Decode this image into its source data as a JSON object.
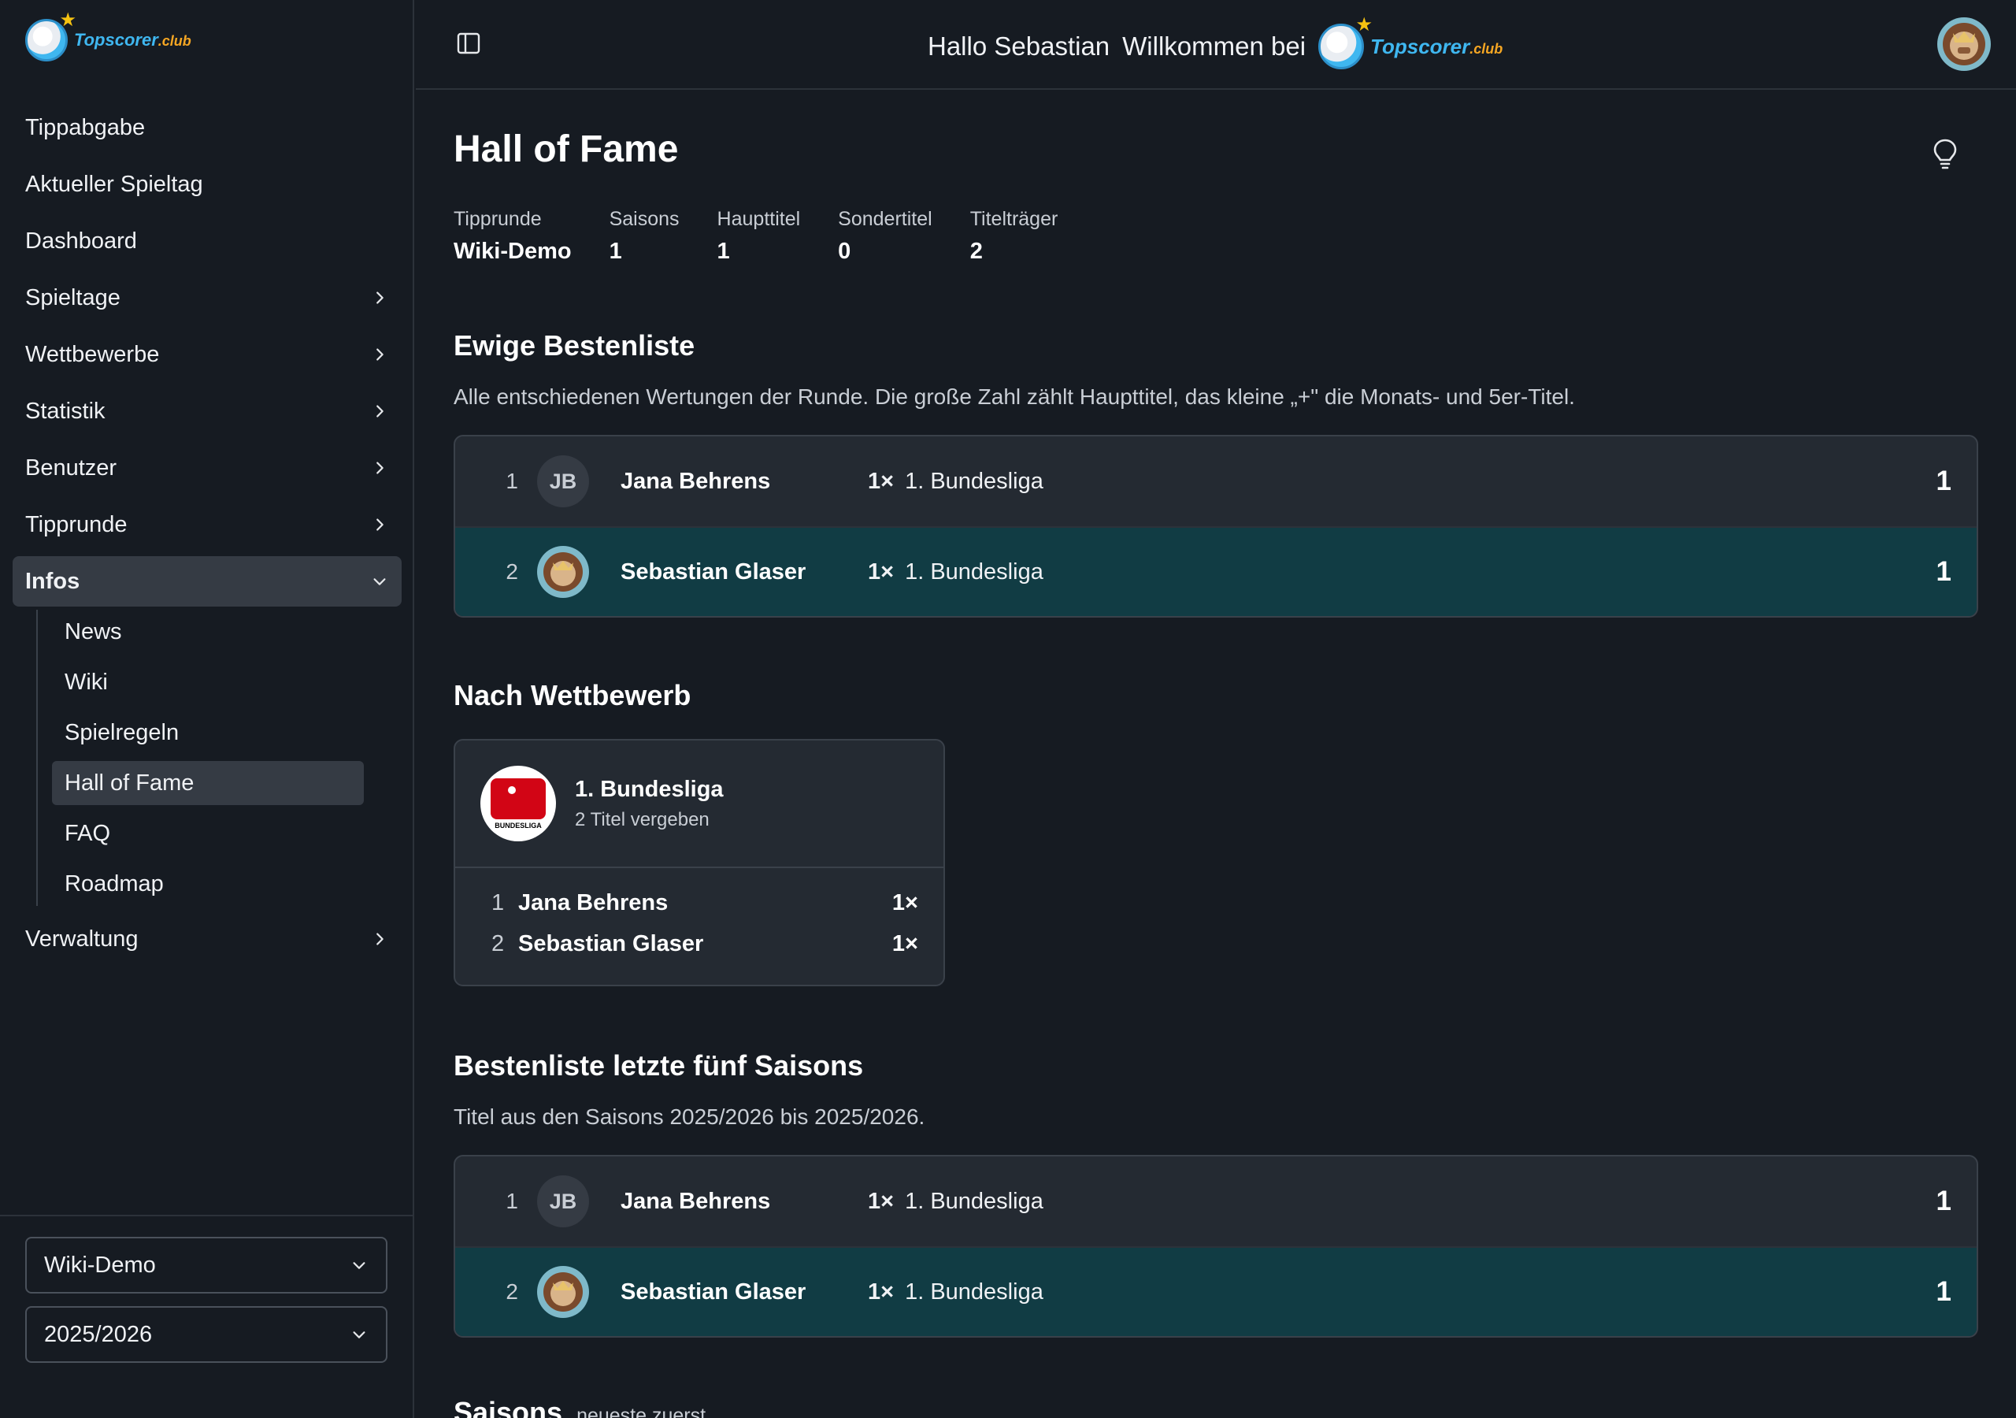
{
  "brand": {
    "name": "Topscorer",
    "suffix": ".club"
  },
  "sidebar": {
    "items": [
      {
        "label": "Tippabgabe",
        "chevron": false
      },
      {
        "label": "Aktueller Spieltag",
        "chevron": false
      },
      {
        "label": "Dashboard",
        "chevron": false
      },
      {
        "label": "Spieltage",
        "chevron": true
      },
      {
        "label": "Wettbewerbe",
        "chevron": true
      },
      {
        "label": "Statistik",
        "chevron": true
      },
      {
        "label": "Benutzer",
        "chevron": true
      },
      {
        "label": "Tipprunde",
        "chevron": true
      },
      {
        "label": "Infos",
        "expanded": true
      }
    ],
    "subitems": [
      "News",
      "Wiki",
      "Spielregeln",
      "Hall of Fame",
      "FAQ",
      "Roadmap"
    ],
    "active_subitem": "Hall of Fame",
    "last_item": "Verwaltung",
    "round_select": "Wiki-Demo",
    "season_select": "2025/2026"
  },
  "topbar": {
    "greeting": "Hallo Sebastian",
    "welcome": "Willkommen bei"
  },
  "page": {
    "title": "Hall of Fame",
    "stats": [
      {
        "label": "Tipprunde",
        "value": "Wiki-Demo"
      },
      {
        "label": "Saisons",
        "value": "1"
      },
      {
        "label": "Haupttitel",
        "value": "1"
      },
      {
        "label": "Sondertitel",
        "value": "0"
      },
      {
        "label": "Titelträger",
        "value": "2"
      }
    ]
  },
  "ewige": {
    "title": "Ewige Bestenliste",
    "desc": "Alle entschiedenen Wertungen der Runde. Die große Zahl zählt Haupttitel, das kleine „+\" die Monats- und 5er-Titel.",
    "rows": [
      {
        "rank": "1",
        "initials": "JB",
        "name": "Jana Behrens",
        "count": "1×",
        "competition": "1. Bundesliga",
        "total": "1"
      },
      {
        "rank": "2",
        "initials": "",
        "name": "Sebastian Glaser",
        "count": "1×",
        "competition": "1. Bundesliga",
        "total": "1"
      }
    ]
  },
  "wettbewerb": {
    "title": "Nach Wettbewerb",
    "card": {
      "name": "1. Bundesliga",
      "sub": "2 Titel vergeben",
      "logo_word": "BUNDESLIGA",
      "rows": [
        {
          "rank": "1",
          "name": "Jana Behrens",
          "count": "1×"
        },
        {
          "rank": "2",
          "name": "Sebastian Glaser",
          "count": "1×"
        }
      ]
    }
  },
  "fuenf": {
    "title": "Bestenliste letzte fünf Saisons",
    "desc": "Titel aus den Saisons 2025/2026 bis 2025/2026.",
    "rows": [
      {
        "rank": "1",
        "initials": "JB",
        "name": "Jana Behrens",
        "count": "1×",
        "competition": "1. Bundesliga",
        "total": "1"
      },
      {
        "rank": "2",
        "initials": "",
        "name": "Sebastian Glaser",
        "count": "1×",
        "competition": "1. Bundesliga",
        "total": "1"
      }
    ]
  },
  "saisons": {
    "title": "Saisons",
    "sub": "neueste zuerst"
  },
  "colors": {
    "background": "#161b22",
    "card": "#242a32",
    "highlight_row": "#113c44",
    "brand_blue": "#3fb7f0",
    "brand_orange": "#f5a623"
  }
}
